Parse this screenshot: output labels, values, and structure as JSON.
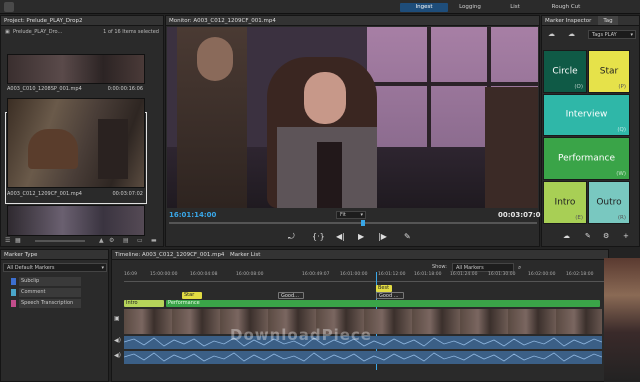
{
  "topbar": {
    "tabs": [
      {
        "label": "Ingest",
        "active": true
      },
      {
        "label": "Logging",
        "active": false
      },
      {
        "label": "List",
        "active": false
      },
      {
        "label": "Rough Cut",
        "active": false
      }
    ]
  },
  "project": {
    "title": "Project: Prelude_PLAY_Drop2",
    "bin": "Prelude_PLAY_Dro...",
    "selected_count": "1 of 16 Items selected",
    "clips": [
      {
        "name": "A003_C010_1208SP_001.mp4",
        "duration": "0:00:00:16:06"
      },
      {
        "name": "A003_C012_1209CF_001.mp4",
        "duration": "00:03:07:02"
      }
    ]
  },
  "monitor": {
    "title": "Monitor: A003_C012_1209CF_001.mp4",
    "current_time": "16:01:14:00",
    "duration": "00:03:07:02",
    "zoom": "Fit"
  },
  "inspector": {
    "tab_label": "Marker Inspector",
    "tag_tab_label": "Tag",
    "tag_set": "Tags PLAY",
    "tiles": [
      {
        "label": "Circle",
        "key": "(O)",
        "color": "#0f5a46"
      },
      {
        "label": "Star",
        "key": "(P)",
        "color": "#e6e24a"
      },
      {
        "label": "Interview",
        "key": "(Q)",
        "color": "#2fb7a8"
      },
      {
        "label": "Performance",
        "key": "(W)",
        "color": "#3aa448"
      },
      {
        "label": "Intro",
        "key": "(E)",
        "color": "#a8cf55"
      },
      {
        "label": "Outro",
        "key": "(R)",
        "color": "#79c8c0"
      }
    ]
  },
  "marker_type": {
    "title": "Marker Type",
    "filter": "All Default Markers",
    "items": [
      {
        "label": "Subclip",
        "color": "#3c6fd0"
      },
      {
        "label": "Comment",
        "color": "#4aa6c9"
      },
      {
        "label": "Speech Transcription",
        "color": "#c24d8b"
      }
    ]
  },
  "timeline": {
    "title": "Timeline: A003_C012_1209CF_001.mp4",
    "tab2": "Marker List",
    "show_label": "Show:",
    "show_value": "All Markers",
    "ruler": [
      "16:09",
      "15:00:00:00",
      "16:00:04:08",
      "16:00:08:00",
      "16:00:00:00",
      "16:00:01:00",
      "16:00:49:07",
      "16:01:00:00",
      "16:01:12:00",
      "16:01:18:00",
      "16:01:24:00",
      "16:01:30:00",
      "16:02:00:00",
      "16:02:18:00"
    ],
    "markers": [
      "Intro",
      "Performance",
      "Star",
      "Good...",
      "Good ...",
      "Best",
      "Good..."
    ]
  },
  "watermark": "DownloadPiece"
}
